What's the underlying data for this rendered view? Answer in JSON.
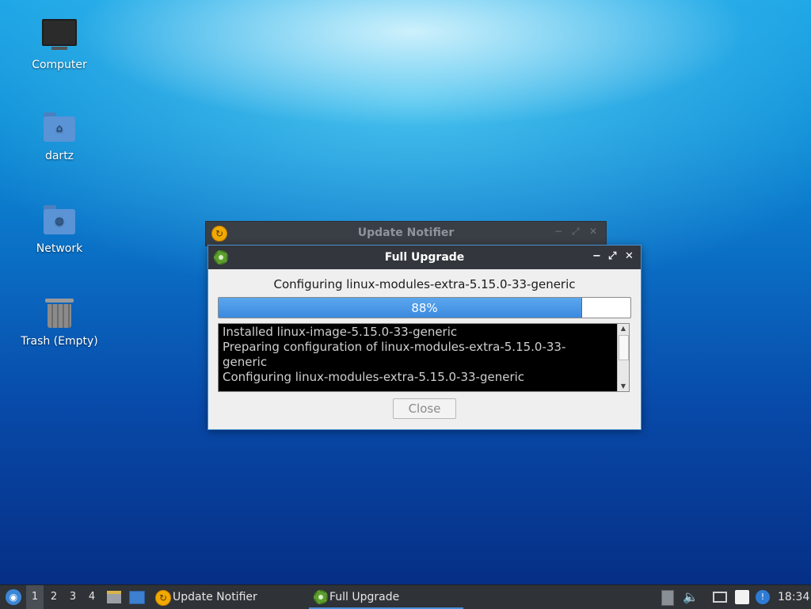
{
  "desktop": {
    "icons": [
      {
        "label": "Computer",
        "icon": "computer-icon"
      },
      {
        "label": "dartz",
        "icon": "home-folder-icon"
      },
      {
        "label": "Network",
        "icon": "network-folder-icon"
      },
      {
        "label": "Trash (Empty)",
        "icon": "trash-icon"
      }
    ]
  },
  "background_window": {
    "title": "Update Notifier",
    "icon": "update-notifier-icon"
  },
  "dialog": {
    "title": "Full Upgrade",
    "icon": "gear-icon",
    "status": "Configuring linux-modules-extra-5.15.0-33-generic",
    "progress": {
      "percent": 88,
      "label": "88%"
    },
    "log_lines": [
      "Installed linux-image-5.15.0-33-generic",
      "Preparing configuration of linux-modules-extra-5.15.0-33-",
      "generic",
      "Configuring linux-modules-extra-5.15.0-33-generic"
    ],
    "close_label": "Close",
    "window_controls": {
      "minimize": "−",
      "maximize": "⤢",
      "close": "✕"
    }
  },
  "taskbar": {
    "workspaces": [
      "1",
      "2",
      "3",
      "4"
    ],
    "active_workspace": "1",
    "tasks": [
      {
        "label": "Update Notifier",
        "icon": "update-notifier-icon",
        "active": false
      },
      {
        "label": "Full Upgrade",
        "icon": "gear-icon",
        "active": true
      }
    ],
    "clock": "18:34"
  },
  "colors": {
    "accent": "#4a90d9",
    "progress_fill": "#3c8ae0",
    "taskbar_bg": "#2f3237"
  }
}
